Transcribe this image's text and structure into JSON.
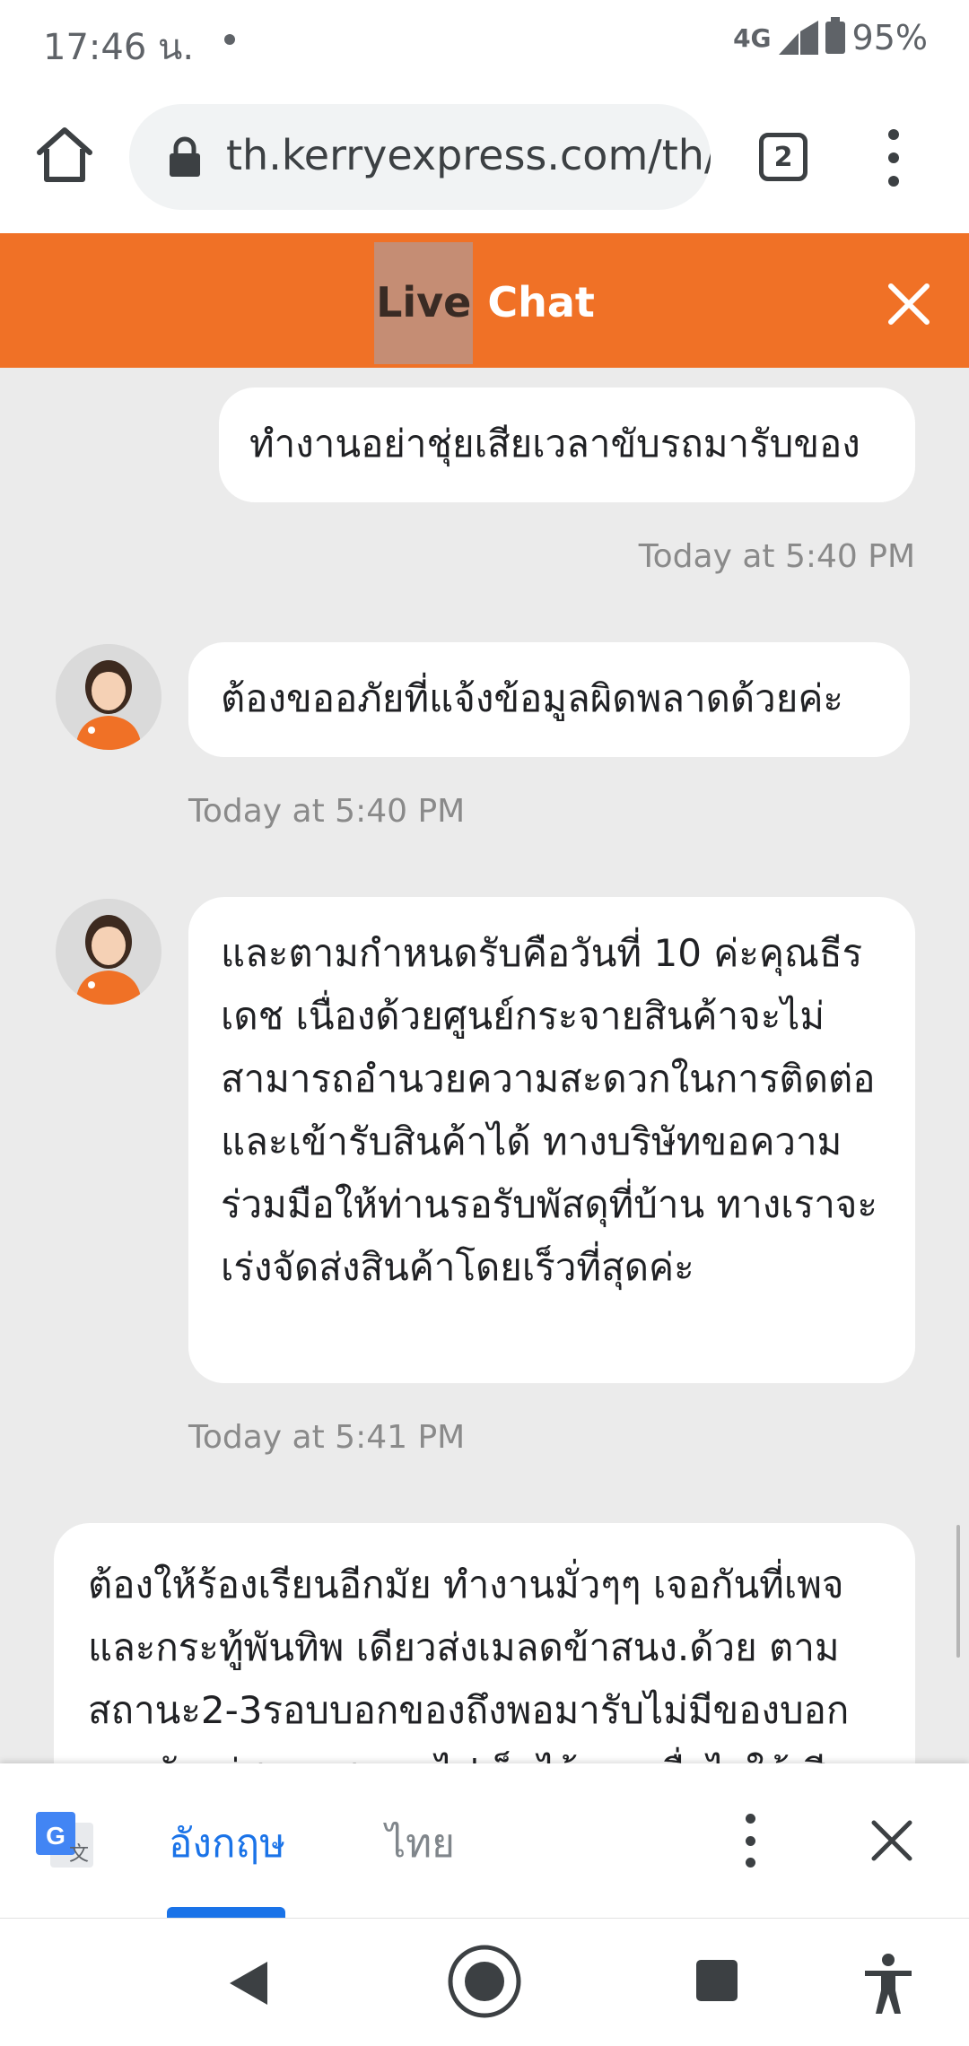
{
  "status_bar": {
    "time": "17:46 น.",
    "network": "4G",
    "battery": "95%"
  },
  "browser": {
    "url": "th.kerryexpress.com/th/",
    "tab_count": "2"
  },
  "chat": {
    "title_part1": "Live",
    "title_part2": " Chat",
    "messages": [
      {
        "sender": "user",
        "text": "ทำงานอย่าชุ่ยเสียเวลาขับรถมารับของ",
        "time": "Today at 5:40 PM"
      },
      {
        "sender": "agent",
        "text": "ต้องขออภัยที่แจ้งข้อมูลผิดพลาดด้วยค่ะ",
        "time": "Today at 5:40 PM"
      },
      {
        "sender": "agent",
        "text": "และตามกำหนดรับคือวันที่ 10 ค่ะคุณธีรเดช เนื่องด้วยศูนย์กระจายสินค้าจะไม่สามารถอำนวยความสะดวกในการติดต่อและเข้ารับสินค้าได้ ทางบริษัทขอความร่วมมือให้ท่านรอรับพัสดุที่บ้าน ทางเราจะเร่งจัดส่งสินค้าโดยเร็วที่สุดค่ะ",
        "time": "Today at 5:41 PM"
      },
      {
        "sender": "user",
        "text": "ต้องให้ร้องเรียนอีกมัย ทำงานมั่วๆๆ เจอกันที่เพจและกระทู้พันทิพ เดียวส่งเมลดข้าสนง.ด้วย ตามสถานะ2-3รอบบอกของถึงพอมารับไม่มีของบอกของยังอยู่สนหรสาคร ไปเก็บไว้ถามเพื่อไรให้เสีย"
      }
    ]
  },
  "translate_bar": {
    "lang_source": "อังกฤษ",
    "lang_target": "ไทย"
  }
}
